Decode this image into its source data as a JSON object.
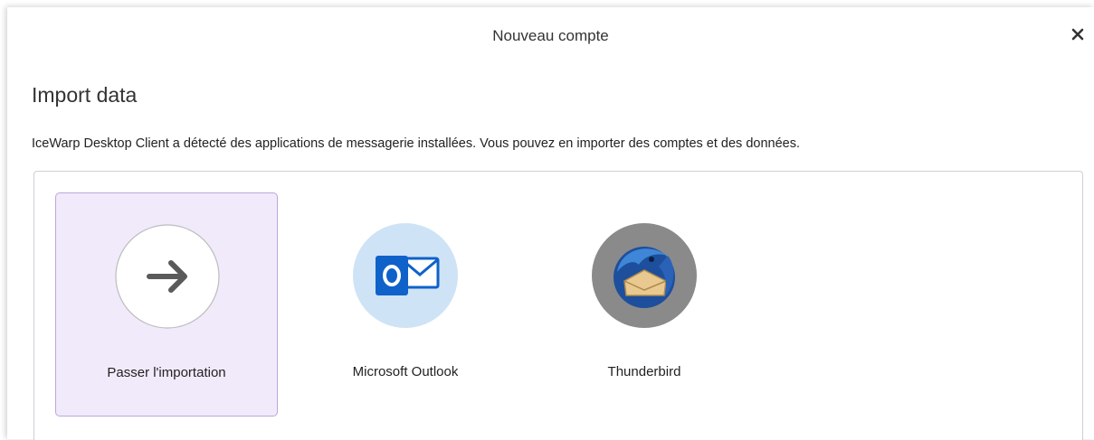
{
  "dialog": {
    "title": "Nouveau compte",
    "close_symbol": "✕"
  },
  "heading": "Import data",
  "description": "IceWarp Desktop Client a détecté des applications de messagerie installées. Vous pouvez en importer des comptes et des données.",
  "options": [
    {
      "label": "Passer l'importation",
      "icon": "arrow-right-icon",
      "selected": true
    },
    {
      "label": "Microsoft Outlook",
      "icon": "outlook-icon",
      "selected": false
    },
    {
      "label": "Thunderbird",
      "icon": "thunderbird-icon",
      "selected": false
    }
  ],
  "colors": {
    "selected_bg": "#f1eafb",
    "selected_border": "#bca6dc",
    "outlook_blue": "#0f62c9"
  }
}
